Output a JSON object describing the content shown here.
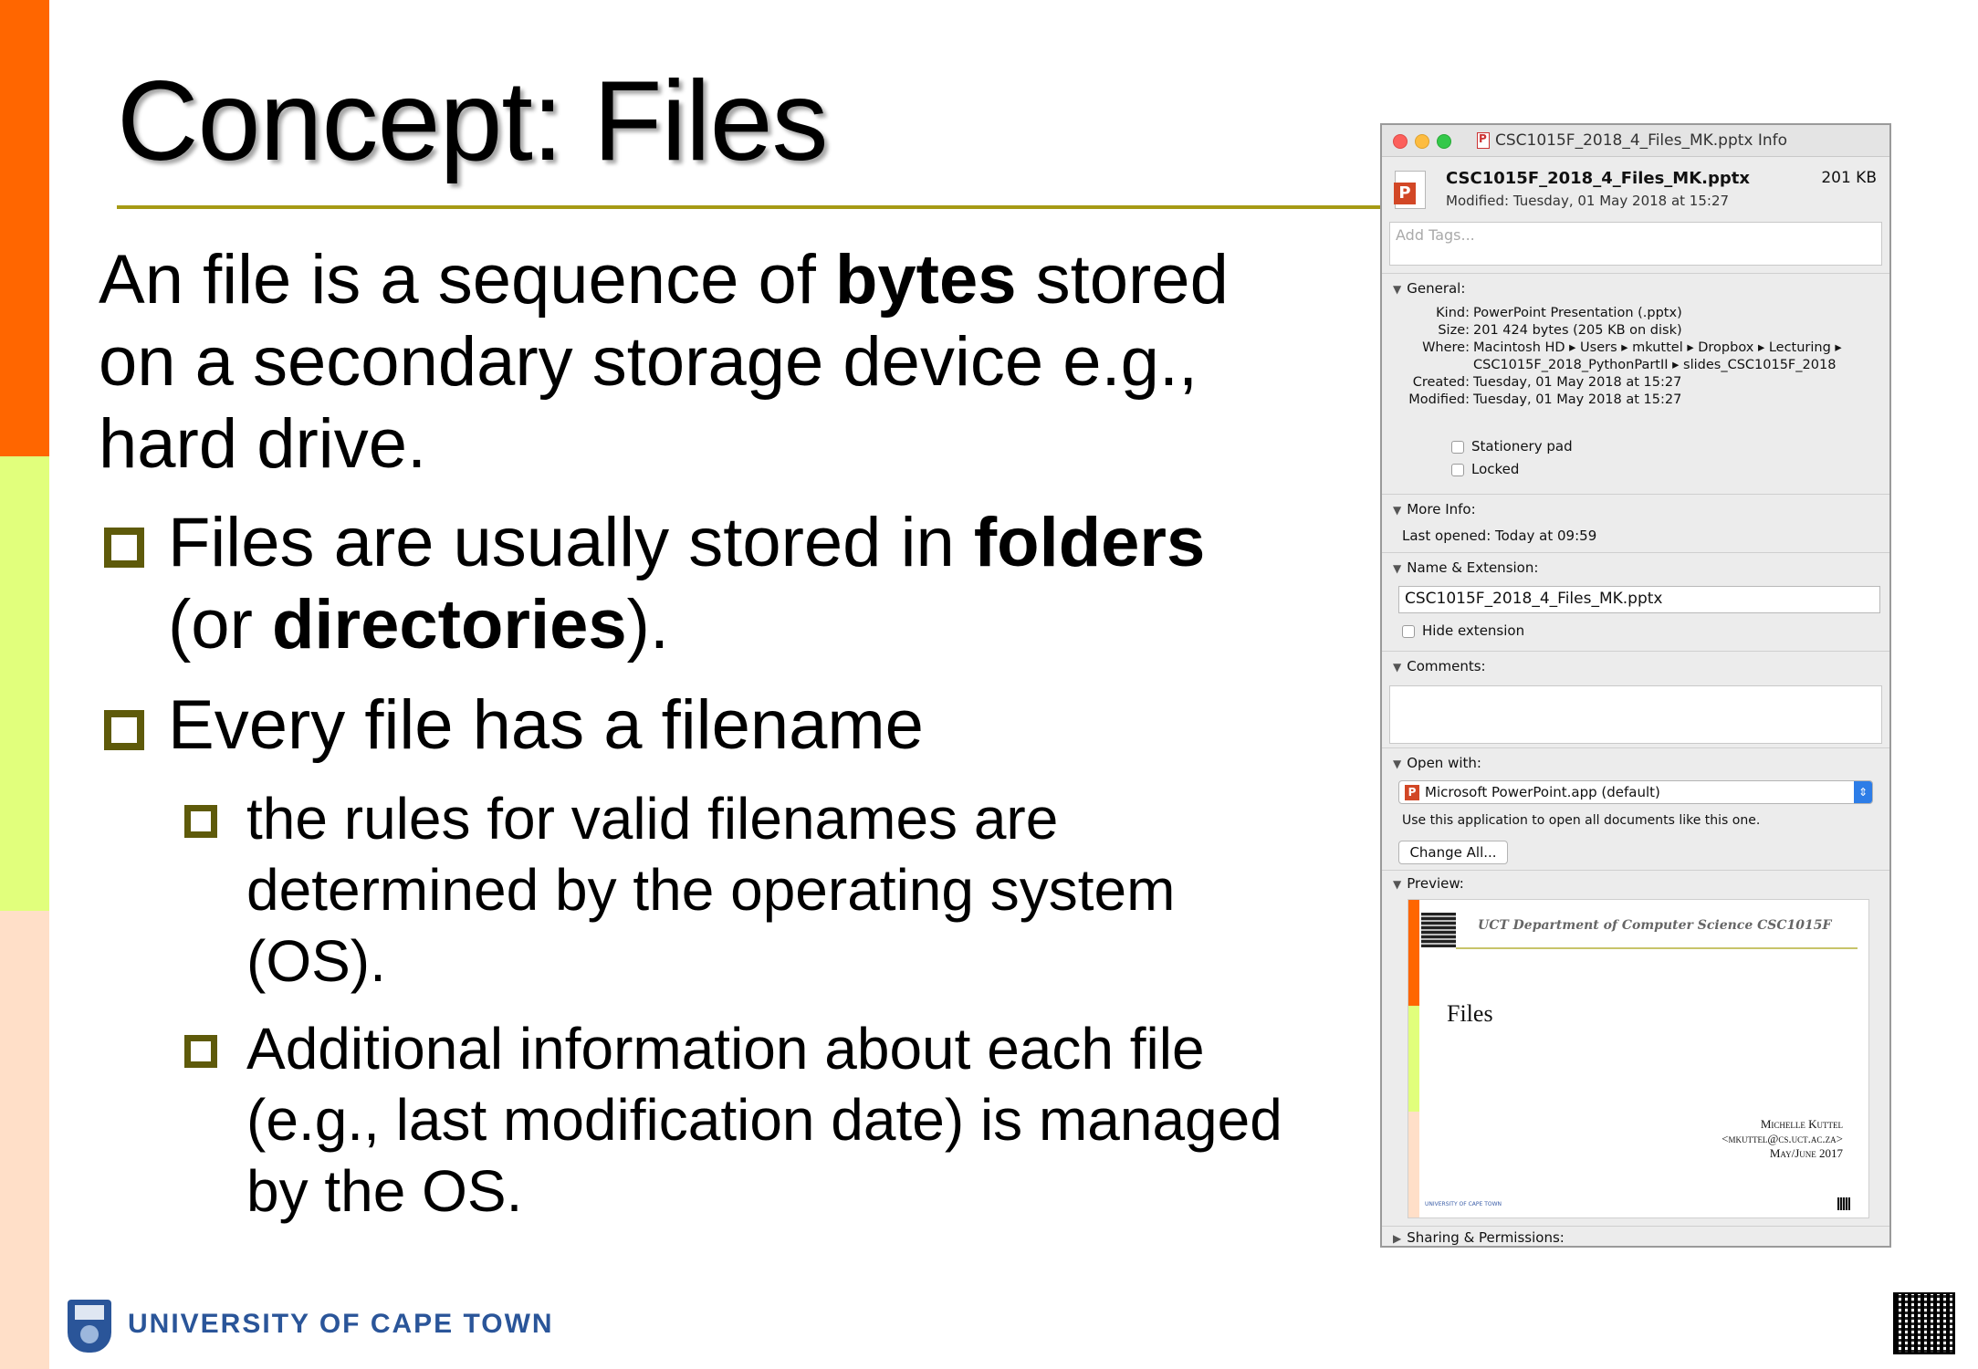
{
  "slide": {
    "title": "Concept: Files",
    "intro_parts": [
      "An file is a sequence of ",
      "bytes",
      " stored on a secondary storage device e.g., hard drive."
    ],
    "bullet1_parts": [
      "Files are usually stored in ",
      "folders",
      " (or ",
      "directories",
      ")."
    ],
    "bullet2": "Every file has a filename",
    "sub1": "the rules for valid filenames are determined by the operating system (OS).",
    "sub2": "Additional information about each file (e.g., last modification date) is managed by the OS.",
    "footer_org": "UNIVERSITY OF CAPE TOWN"
  },
  "info_window": {
    "title": "CSC1015F_2018_4_Files_MK.pptx Info",
    "file_name": "CSC1015F_2018_4_Files_MK.pptx",
    "file_size": "201 KB",
    "modified_line": "Modified: Tuesday, 01 May 2018 at 15:27",
    "tags_placeholder": "Add Tags...",
    "general_label": "General:",
    "general": [
      {
        "key": "Kind:",
        "value": "PowerPoint Presentation (.pptx)"
      },
      {
        "key": "Size:",
        "value": "201 424 bytes (205 KB on disk)"
      },
      {
        "key": "Where:",
        "value": "Macintosh HD ▸ Users ▸ mkuttel ▸ Dropbox ▸ Lecturing ▸"
      },
      {
        "key": "",
        "value": "CSC1015F_2018_PythonPartII ▸ slides_CSC1015F_2018"
      },
      {
        "key": "Created:",
        "value": "Tuesday, 01 May 2018 at 15:27"
      },
      {
        "key": "Modified:",
        "value": "Tuesday, 01 May 2018 at 15:27"
      }
    ],
    "stationery_label": "Stationery pad",
    "locked_label": "Locked",
    "more_info_label": "More Info:",
    "last_opened": "Last opened: Today at 09:59",
    "name_ext_label": "Name & Extension:",
    "name_field_value": "CSC1015F_2018_4_Files_MK.pptx",
    "hide_extension_label": "Hide extension",
    "comments_label": "Comments:",
    "open_with_label": "Open with:",
    "open_with_app": "Microsoft PowerPoint.app (default)",
    "open_with_note": "Use this application to open all documents like this one.",
    "change_all_label": "Change All...",
    "preview_label": "Preview:",
    "preview": {
      "header": "UCT Department of Computer Science   CSC1015F",
      "title": "Files",
      "author_lines": [
        "Michelle Kuttel",
        "<mkuttel@cs.uct.ac.za>",
        "May/June 2017"
      ],
      "footer": "UNIVERSITY OF CAPE TOWN"
    },
    "sharing_label": "Sharing & Permissions:"
  },
  "colors": {
    "strip_top": "#ff6600",
    "strip_mid": "#e1ff7c",
    "strip_bottom": "#ffdfc8",
    "rule": "#a69a14",
    "bullet_marker": "#5e5a0a",
    "uct_blue": "#2a5599"
  }
}
